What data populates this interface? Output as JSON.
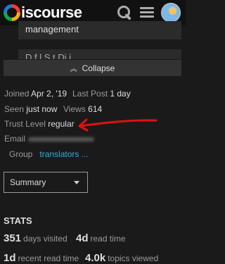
{
  "header": {
    "logo_text": "iscourse",
    "icons": [
      "search-icon",
      "menu-icon",
      "avatar"
    ]
  },
  "cards": {
    "first_text": "management",
    "second_text": "D             f     l  S  t   Di  i"
  },
  "collapse": {
    "label": "Collapse"
  },
  "profile": {
    "joined_label": "Joined",
    "joined_value": "Apr 2, '19",
    "last_post_label": "Last Post",
    "last_post_value": "1 day",
    "seen_label": "Seen",
    "seen_value": "just now",
    "views_label": "Views",
    "views_value": "614",
    "trust_label": "Trust Level",
    "trust_value": "regular",
    "email_label": "Email",
    "group_label": "Group",
    "group_value": "translators ..."
  },
  "summary_select": {
    "selected": "Summary"
  },
  "stats": {
    "title": "STATS",
    "days_visited": {
      "num": "351",
      "label": "days visited"
    },
    "read_time": {
      "num": "4d",
      "label": "read time"
    },
    "recent_read_time": {
      "num": "1d",
      "label": "recent read time"
    },
    "topics_viewed": {
      "num": "4.0k",
      "label": "topics viewed"
    }
  },
  "colors": {
    "accent_link": "#3fa8d9",
    "annotation_arrow": "#e01010"
  }
}
